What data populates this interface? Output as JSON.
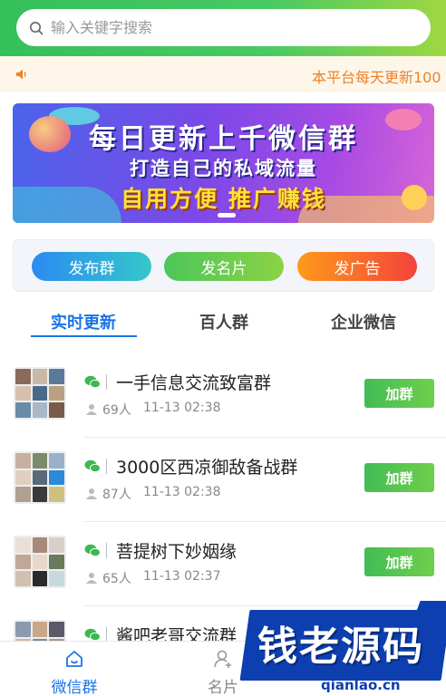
{
  "search": {
    "placeholder": "输入关键字搜索"
  },
  "notice": {
    "text": "本平台每天更新100"
  },
  "banner": {
    "line1": "每日更新上千微信群",
    "line2": "打造自己的私域流量",
    "line3": "自用方便  推广赚钱"
  },
  "actions": {
    "publish_group": "发布群",
    "publish_card": "发名片",
    "publish_ad": "发广告"
  },
  "tabs": {
    "realtime": "实时更新",
    "hundred": "百人群",
    "enterprise": "企业微信"
  },
  "groups": [
    {
      "name": "一手信息交流致富群",
      "members": "69人",
      "time": "11-13 02:38",
      "join": "加群"
    },
    {
      "name": "3000区西凉御敌备战群",
      "members": "87人",
      "time": "11-13 02:38",
      "join": "加群"
    },
    {
      "name": "菩提树下妙姻缘",
      "members": "65人",
      "time": "11-13 02:37",
      "join": "加群"
    },
    {
      "name": "酱吧老哥交流群",
      "members": "",
      "time": "",
      "join": ""
    }
  ],
  "nav": {
    "wechat_group": "微信群",
    "card": "名片"
  },
  "watermark": {
    "text": "钱老源码",
    "url": "qianlao.cn"
  },
  "colors": {
    "accent": "#1a74e8",
    "header_green": "#35c05a",
    "join_green": "#42bc55",
    "notice_orange": "#e8832e"
  }
}
